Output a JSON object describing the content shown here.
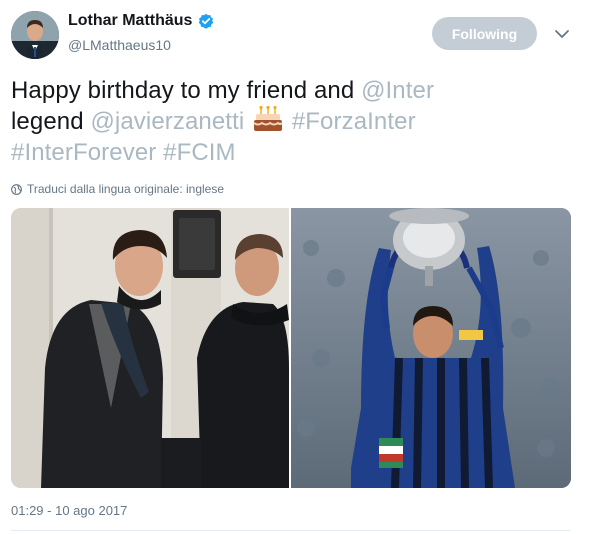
{
  "user": {
    "display_name": "Lothar Matthäus",
    "handle": "@LMatthaeus10",
    "verified": true,
    "avatar_icon": "profile-photo"
  },
  "follow_button": {
    "label": "Following"
  },
  "menu_icon": "chevron-down-icon",
  "tweet": {
    "text_1": "Happy birthday to my friend and ",
    "mention_inter": "@Inter",
    "text_2": "legend ",
    "mention_zanetti": "@javierzanetti",
    "emoji": "birthday-cake-emoji",
    "hashtag_1": "#ForzaInter",
    "hashtag_2": "#InterForever",
    "hashtag_3": "#FCIM"
  },
  "translate": {
    "label": "Traduci dalla lingua originale: inglese",
    "icon": "globe-icon"
  },
  "photos": [
    {
      "name": "photo-friends-portrait"
    },
    {
      "name": "photo-trophy-celebration"
    }
  ],
  "timestamp": "01:29 - 10 ago 2017",
  "colors": {
    "link": "#aab8c2",
    "verified_badge": "#1da1f2",
    "follow_button_bg": "#c4cdd6",
    "secondary_text": "#657786"
  }
}
